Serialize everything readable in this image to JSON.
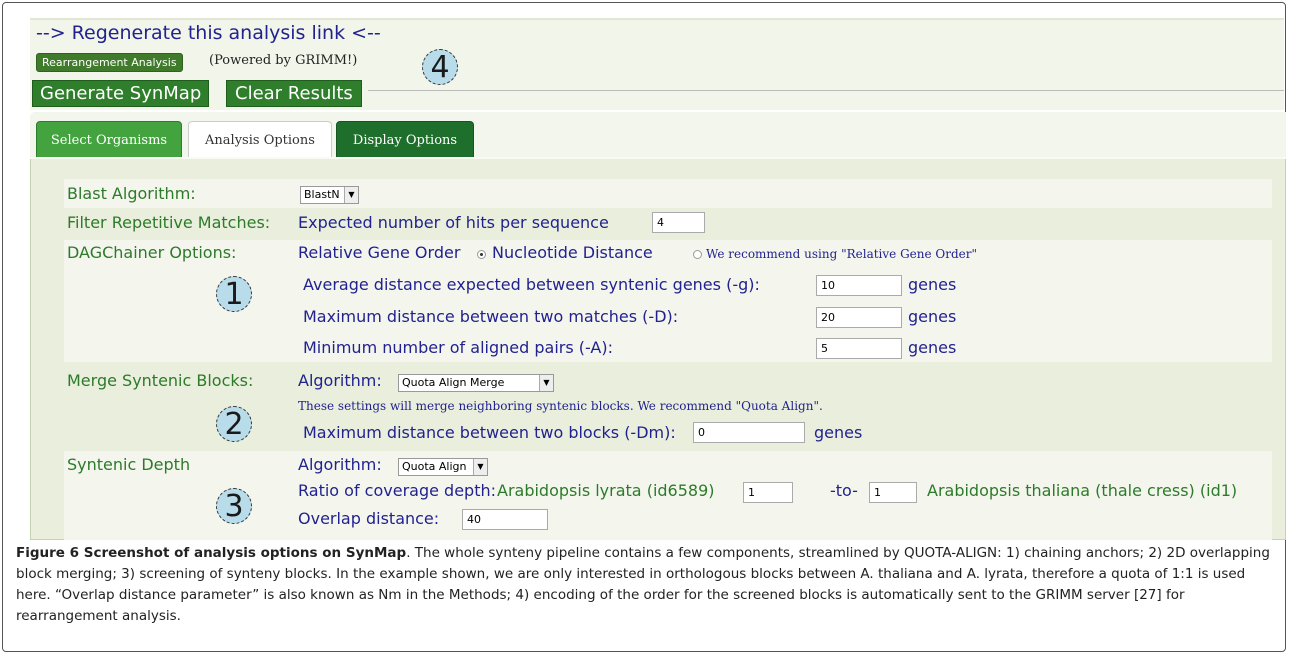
{
  "header": {
    "regenerate_link": "--> Regenerate this analysis link <--",
    "rearrangement_button": "Rearrangement Analysis",
    "powered_by": "(Powered by GRIMM!)",
    "generate_button": "Generate SynMap",
    "clear_button": "Clear Results"
  },
  "tabs": [
    {
      "label": "Select Organisms"
    },
    {
      "label": "Analysis Options"
    },
    {
      "label": "Display Options"
    }
  ],
  "blast": {
    "label": "Blast Algorithm:",
    "value": "BlastN"
  },
  "filter": {
    "label": "Filter Repetitive Matches:",
    "text": "Expected number of hits per sequence",
    "value": "4"
  },
  "dagchainer": {
    "label": "DAGChainer Options:",
    "opt_relative": "Relative Gene Order",
    "opt_nucleotide": "Nucleotide Distance",
    "recommend": "We recommend using \"Relative Gene Order\"",
    "avg_label": "Average distance expected between syntenic genes (-g):",
    "avg_value": "10",
    "max_label": "Maximum distance between two matches (-D):",
    "max_value": "20",
    "min_label": "Minimum number of aligned pairs (-A):",
    "min_value": "5",
    "unit": "genes"
  },
  "merge": {
    "label": "Merge Syntenic Blocks:",
    "algo_label": "Algorithm:",
    "algo_value": "Quota Align Merge",
    "note": "These settings will merge neighboring syntenic blocks. We recommend \"Quota Align\".",
    "dist_label": "Maximum distance between two blocks (-Dm):",
    "dist_value": "0",
    "unit": "genes"
  },
  "depth": {
    "label": "Syntenic Depth",
    "algo_label": "Algorithm:",
    "algo_value": "Quota Align",
    "ratio_label": "Ratio of coverage depth:",
    "org1": "Arabidopsis lyrata (id6589)",
    "org1_value": "1",
    "to": "-to-",
    "org2_value": "1",
    "org2": "Arabidopsis thaliana (thale cress) (id1)",
    "overlap_label": "Overlap distance:",
    "overlap_value": "40"
  },
  "markers": [
    "1",
    "2",
    "3",
    "4"
  ],
  "caption": {
    "title": "Figure 6 Screenshot of analysis options on SynMap",
    "body": ". The whole synteny pipeline contains a few components, streamlined by QUOTA-ALIGN: 1) chaining anchors; 2) 2D overlapping block merging; 3) screening of synteny blocks. In the example shown, we are only interested in orthologous blocks between A. thaliana and A. lyrata, therefore a quota of 1:1 is used here. “Overlap distance parameter” is also known as Nm in the Methods; 4) encoding of the order for the screened blocks is automatically sent to the GRIMM server [27] for rearrangement analysis."
  }
}
